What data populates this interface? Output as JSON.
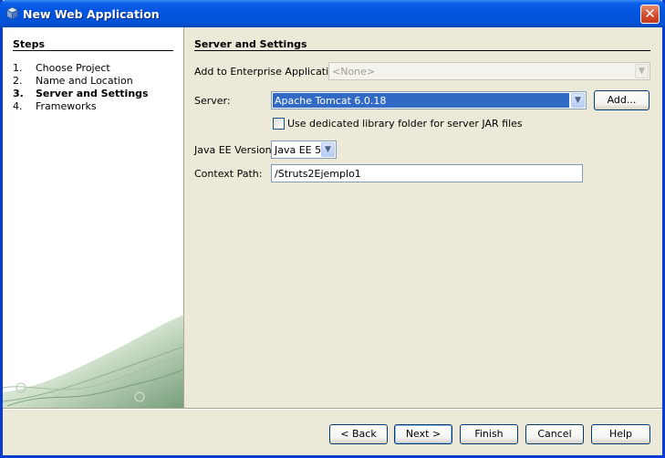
{
  "window": {
    "title": "New Web Application",
    "close_glyph": "✕"
  },
  "steps": {
    "title": "Steps",
    "items": [
      {
        "num": "1.",
        "label": "Choose Project"
      },
      {
        "num": "2.",
        "label": "Name and Location"
      },
      {
        "num": "3.",
        "label": "Server and Settings"
      },
      {
        "num": "4.",
        "label": "Frameworks"
      }
    ],
    "active_index": 2
  },
  "content": {
    "title": "Server and Settings",
    "enterprise_label": "Add to Enterprise Application:",
    "enterprise_value": "<None>",
    "server_label": "Server:",
    "server_value": "Apache Tomcat 6.0.18",
    "add_label": "Add...",
    "library_checkbox_label": "Use dedicated library folder for server JAR files",
    "library_checked": false,
    "javaee_label": "Java EE Version:",
    "javaee_value": "Java EE 5",
    "context_label": "Context Path:",
    "context_value": "/Struts2Ejemplo1"
  },
  "footer": {
    "back": "< Back",
    "next": "Next >",
    "finish": "Finish",
    "cancel": "Cancel",
    "help": "Help"
  },
  "colors": {
    "titlebar": "#0455e0",
    "selection": "#316ac5",
    "dialog_bg": "#ece9d8"
  }
}
